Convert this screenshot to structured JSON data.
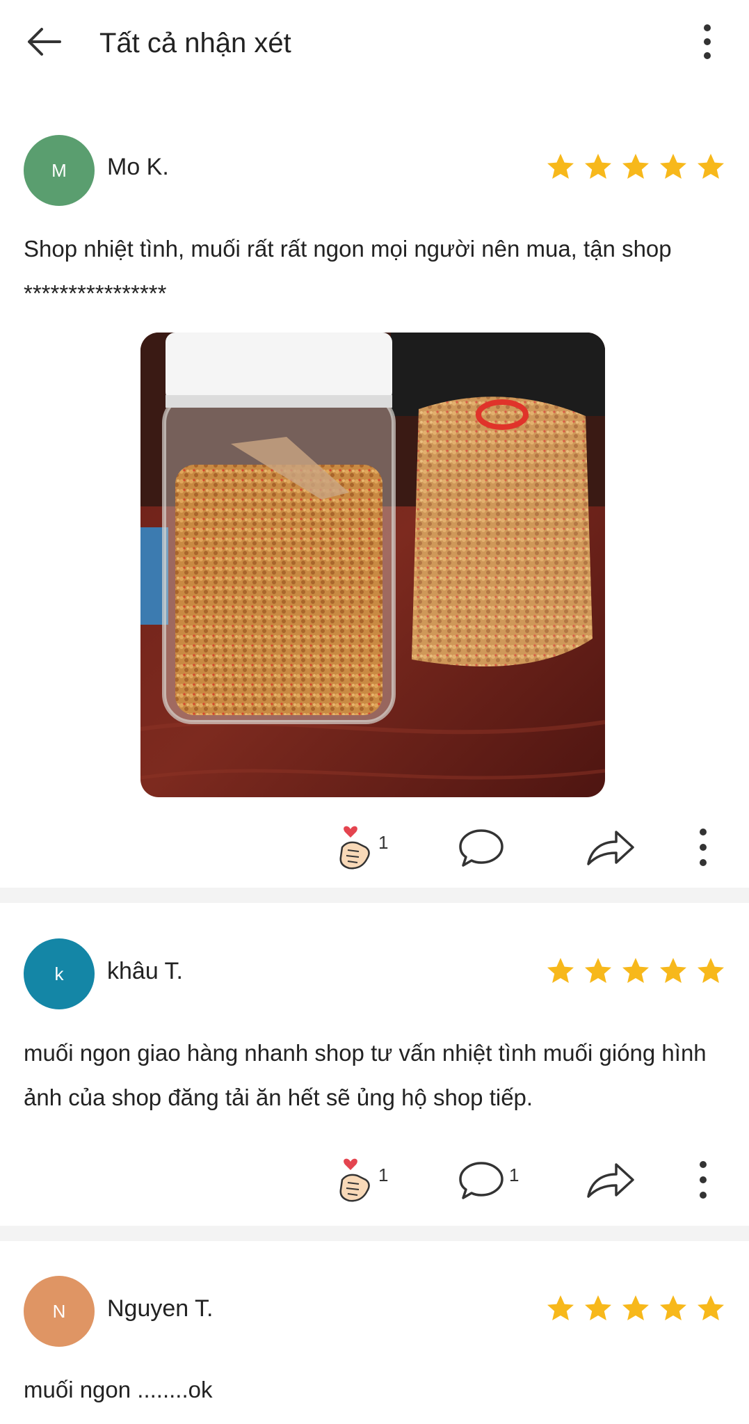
{
  "header": {
    "title": "Tất cả nhận xét",
    "back_icon": "arrow-left-icon",
    "menu_icon": "more-vertical-icon"
  },
  "colors": {
    "star": "#f7b81b",
    "divider": "#f3f3f3"
  },
  "reviews": [
    {
      "avatar_letter": "M",
      "avatar_color": "#5a9e6f",
      "name": "Mo K.",
      "rating": 5,
      "text": "Shop nhiệt tình, muối rất rất ngon mọi người nên mua, tận shop ****************",
      "has_photo": true,
      "likes": "1",
      "comments": ""
    },
    {
      "avatar_letter": "k",
      "avatar_color": "#1486a6",
      "name": "khâu T.",
      "rating": 5,
      "text": "muối ngon giao hàng nhanh shop tư vấn nhiệt tình muối gióng hình ảnh của shop đăng tải ăn hết sẽ ủng hộ shop tiếp.",
      "has_photo": false,
      "likes": "1",
      "comments": "1"
    },
    {
      "avatar_letter": "N",
      "avatar_color": "#df9564",
      "name": "Nguyen T.",
      "rating": 5,
      "text": "muối ngon ........ok",
      "has_photo": false
    }
  ]
}
